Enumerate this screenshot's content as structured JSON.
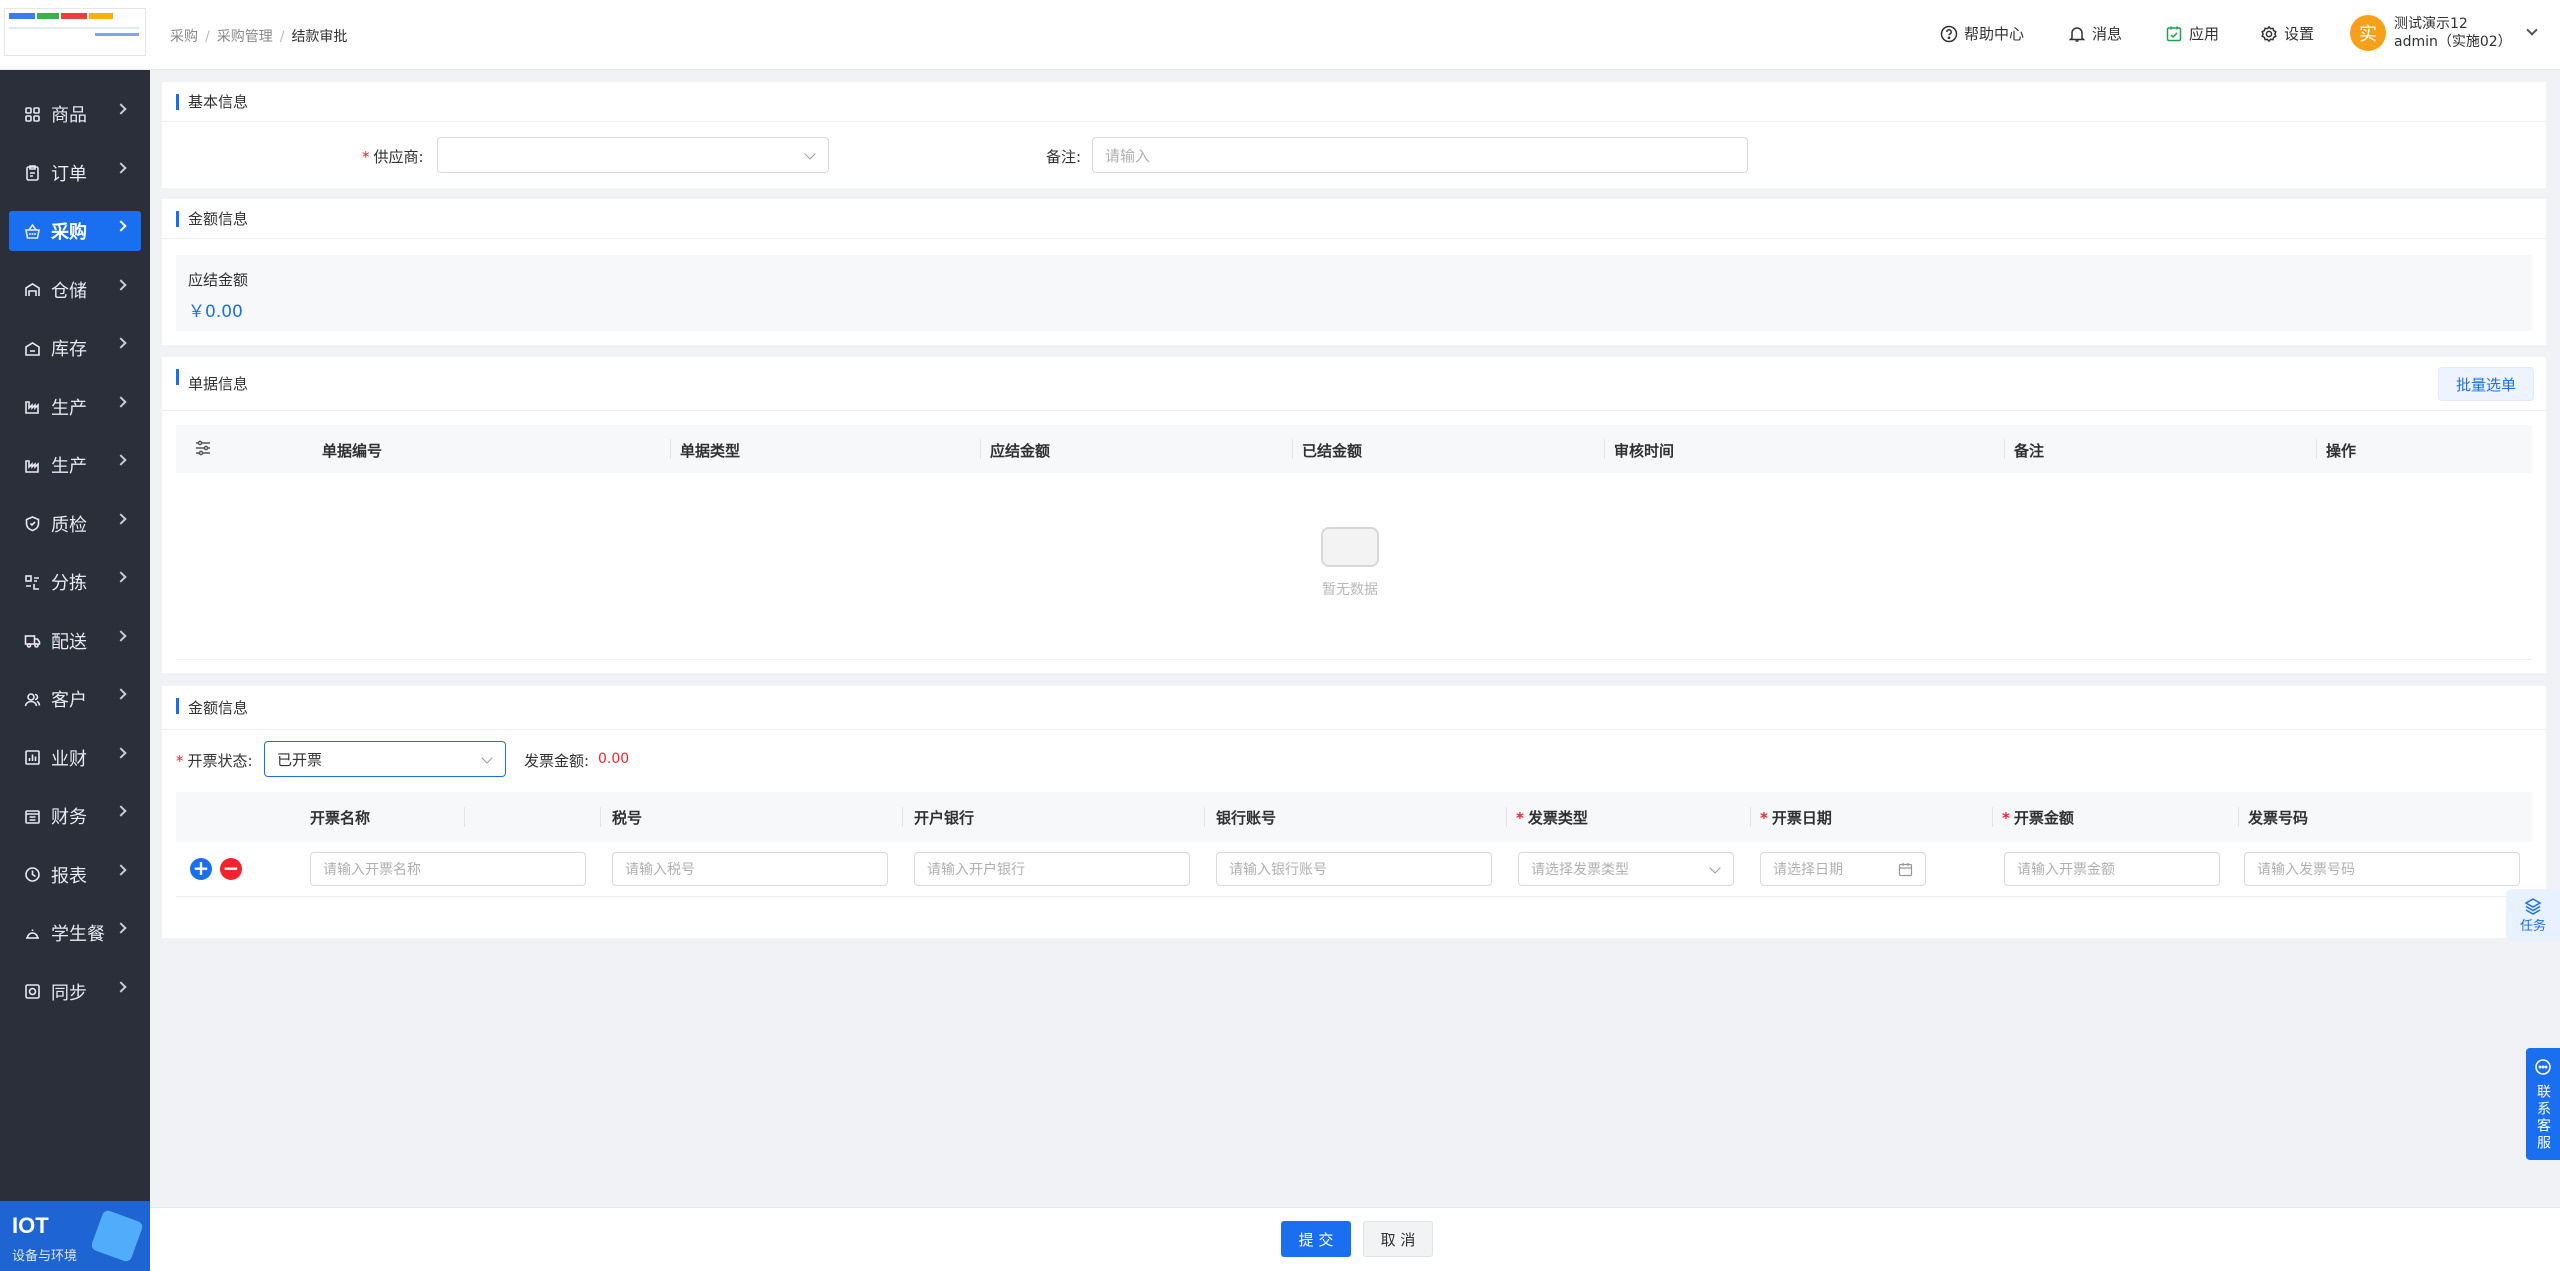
{
  "header": {
    "breadcrumb": [
      "采购",
      "采购管理",
      "结款审批"
    ],
    "help": "帮助中心",
    "messages": "消息",
    "apps": "应用",
    "settings": "设置",
    "user_avatar": "实",
    "user_name": "测试演示12",
    "user_account": "admin（实施02）"
  },
  "sidebar": {
    "items": [
      {
        "label": "商品",
        "icon": "grid-icon"
      },
      {
        "label": "订单",
        "icon": "clipboard-icon"
      },
      {
        "label": "采购",
        "icon": "basket-icon"
      },
      {
        "label": "仓储",
        "icon": "warehouse-icon"
      },
      {
        "label": "库存",
        "icon": "inventory-icon"
      },
      {
        "label": "生产",
        "icon": "factory-icon"
      },
      {
        "label": "生产",
        "icon": "factory-icon"
      },
      {
        "label": "质检",
        "icon": "shield-icon"
      },
      {
        "label": "分拣",
        "icon": "sort-icon"
      },
      {
        "label": "配送",
        "icon": "truck-icon"
      },
      {
        "label": "客户",
        "icon": "users-icon"
      },
      {
        "label": "业财",
        "icon": "chart-icon"
      },
      {
        "label": "财务",
        "icon": "finance-icon"
      },
      {
        "label": "报表",
        "icon": "clock-icon"
      },
      {
        "label": "学生餐",
        "icon": "meal-icon"
      },
      {
        "label": "同步",
        "icon": "sync-icon"
      }
    ],
    "active_index": 2,
    "iot_title": "IOT",
    "iot_subtitle": "设备与环境"
  },
  "basic": {
    "title": "基本信息",
    "supplier_label": "供应商:",
    "supplier_value": "",
    "remark_label": "备注:",
    "remark_placeholder": "请输入"
  },
  "amount": {
    "title": "金额信息",
    "due_label": "应结金额",
    "due_value": "￥0.00"
  },
  "documents": {
    "title": "单据信息",
    "batch_button": "批量选单",
    "columns": [
      "单据编号",
      "单据类型",
      "应结金额",
      "已结金额",
      "审核时间",
      "备注",
      "操作"
    ],
    "empty_text": "暂无数据"
  },
  "invoice": {
    "title": "金额信息",
    "status_label": "开票状态:",
    "status_value": "已开票",
    "amount_label": "发票金额:",
    "amount_value": "0.00",
    "columns": [
      "开票名称",
      "税号",
      "开户银行",
      "银行账号",
      "发票类型",
      "开票日期",
      "开票金额",
      "发票号码"
    ],
    "required_columns": [
      4,
      5,
      6
    ],
    "placeholders": {
      "name": "请输入开票名称",
      "tax": "请输入税号",
      "bank": "请输入开户银行",
      "account": "请输入银行账号",
      "type": "请选择发票类型",
      "date": "请选择日期",
      "amount": "请输入开票金额",
      "number": "请输入发票号码"
    },
    "add_symbol": "+",
    "remove_symbol": "−"
  },
  "footer": {
    "submit": "提 交",
    "cancel": "取 消"
  },
  "floating": {
    "task": "任务",
    "service": "联系客服"
  },
  "colors": {
    "primary": "#1a6ff0",
    "sidebar_bg": "#2b2f3a",
    "danger": "#f5222d",
    "avatar": "#f7a11a"
  }
}
